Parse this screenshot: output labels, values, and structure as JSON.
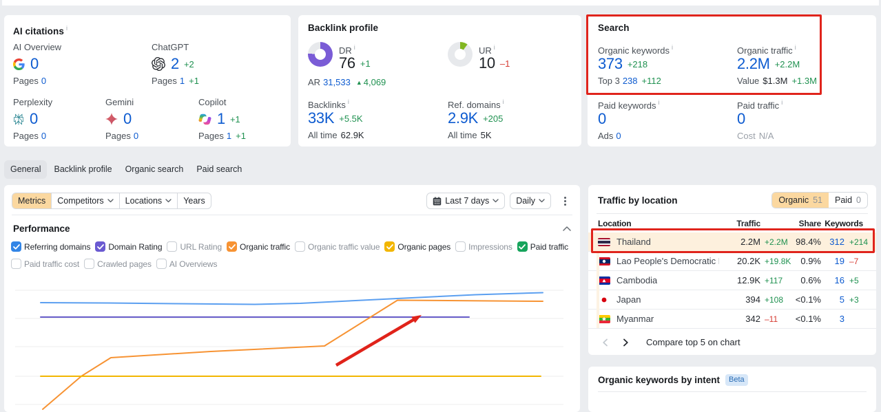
{
  "cards": {
    "ai_citations": {
      "title": "AI citations",
      "metrics": [
        {
          "label": "AI Overview",
          "icon": "google",
          "value": "0",
          "change": "",
          "pages_label": "Pages",
          "pages": "0",
          "pages_change": ""
        },
        {
          "label": "ChatGPT",
          "icon": "chatgpt",
          "value": "2",
          "change": "+2",
          "pages_label": "Pages",
          "pages": "1",
          "pages_change": "+1"
        },
        {
          "label": "Perplexity",
          "icon": "perplexity",
          "value": "0",
          "change": "",
          "pages_label": "Pages",
          "pages": "0",
          "pages_change": ""
        },
        {
          "label": "Gemini",
          "icon": "gemini",
          "value": "0",
          "change": "",
          "pages_label": "Pages",
          "pages": "0",
          "pages_change": ""
        },
        {
          "label": "Copilot",
          "icon": "copilot",
          "value": "1",
          "change": "+1",
          "pages_label": "Pages",
          "pages": "1",
          "pages_change": "+1"
        }
      ]
    },
    "backlink_profile": {
      "title": "Backlink profile",
      "dr": {
        "label": "DR",
        "value": "76",
        "change": "+1",
        "pct": 76,
        "color": "#7a5cd6",
        "track": "#e7e9ec"
      },
      "ur": {
        "label": "UR",
        "value": "10",
        "change": "–1",
        "pct": 10,
        "color": "#82b622",
        "track": "#e7e9ec"
      },
      "ar": {
        "label": "AR",
        "value": "31,533",
        "change": "4,069"
      },
      "backlinks": {
        "label": "Backlinks",
        "value": "33K",
        "change": "+5.5K",
        "sub_label": "All time",
        "sub_value": "62.9K"
      },
      "ref_domains": {
        "label": "Ref. domains",
        "value": "2.9K",
        "change": "+205",
        "sub_label": "All time",
        "sub_value": "5K"
      }
    },
    "search": {
      "title": "Search",
      "organic_keywords": {
        "label": "Organic keywords",
        "value": "373",
        "change": "+218",
        "sub_label": "Top 3",
        "sub_value": "238",
        "sub_change": "+112"
      },
      "organic_traffic": {
        "label": "Organic traffic",
        "value": "2.2M",
        "change": "+2.2M",
        "sub_label": "Value",
        "sub_value": "$1.3M",
        "sub_change": "+1.3M"
      },
      "paid_keywords": {
        "label": "Paid keywords",
        "value": "0",
        "sub_label": "Ads",
        "sub_value": "0"
      },
      "paid_traffic": {
        "label": "Paid traffic",
        "value": "0",
        "sub_label": "Cost",
        "sub_value": "N/A"
      }
    }
  },
  "tabs": [
    {
      "label": "General",
      "active": true
    },
    {
      "label": "Backlink profile",
      "active": false
    },
    {
      "label": "Organic search",
      "active": false
    },
    {
      "label": "Paid search",
      "active": false
    }
  ],
  "left_panel": {
    "filters": [
      {
        "label": "Metrics",
        "active": true
      },
      {
        "label": "Competitors",
        "dropdown": true
      },
      {
        "label": "Locations",
        "dropdown": true
      },
      {
        "label": "Years"
      }
    ],
    "date_range": "Last 7 days",
    "granularity": "Daily",
    "section_title": "Performance",
    "metrics_row1": [
      {
        "label": "Referring domains",
        "checked": true,
        "color": "#3285e6"
      },
      {
        "label": "Domain Rating",
        "checked": true,
        "color": "#6a5ad1"
      },
      {
        "label": "URL Rating",
        "checked": false
      },
      {
        "label": "Organic traffic",
        "checked": true,
        "color": "#f79333"
      },
      {
        "label": "Organic traffic value",
        "checked": false
      },
      {
        "label": "Organic pages",
        "checked": true,
        "color": "#f2b600"
      },
      {
        "label": "Impressions",
        "checked": false
      },
      {
        "label": "Paid traffic",
        "checked": true,
        "color": "#17a45c"
      }
    ],
    "metrics_row2": [
      {
        "label": "Paid traffic cost",
        "checked": false
      },
      {
        "label": "Crawled pages",
        "checked": false
      },
      {
        "label": "AI Overviews",
        "checked": false
      }
    ]
  },
  "chart_data": {
    "type": "line",
    "title": "",
    "xlabel": "",
    "ylabel": "",
    "note": "No axis tick labels are visible in the screenshot; point coordinates are pixel positions inside the 836x189 visible plot area (y grows downward), read from the rendered lines.",
    "grid": {
      "x0": 16,
      "x1": 812,
      "gridlines_y": [
        12,
        53,
        94,
        137,
        178
      ],
      "color": "#ededee"
    },
    "series": [
      {
        "name": "Referring domains",
        "color": "#5b9ff0",
        "points": [
          [
            53,
            30
          ],
          [
            150,
            30.5
          ],
          [
            250,
            31.5
          ],
          [
            364,
            32.5
          ],
          [
            430,
            31
          ],
          [
            510,
            27
          ],
          [
            571,
            24
          ],
          [
            684,
            18.5
          ],
          [
            782,
            15.5
          ]
        ]
      },
      {
        "name": "Domain Rating",
        "color": "#655bc8",
        "points": [
          [
            53,
            51
          ],
          [
            675,
            51
          ]
        ]
      },
      {
        "name": "Organic traffic",
        "color": "#f79333",
        "points": [
          [
            56,
            185
          ],
          [
            112,
            137
          ],
          [
            155,
            110
          ],
          [
            300,
            101
          ],
          [
            465,
            93
          ],
          [
            571,
            26.5
          ],
          [
            782,
            28
          ]
        ]
      },
      {
        "name": "Organic pages",
        "color": "#f2b600",
        "points": [
          [
            53,
            137
          ],
          [
            779,
            137
          ]
        ]
      }
    ],
    "legend": "checkbox row above chart acts as legend",
    "annotation_arrow": {
      "from": [
        482,
        121
      ],
      "to": [
        606,
        48
      ],
      "color": "#e0231a",
      "width": 4.5
    }
  },
  "traffic_by_location": {
    "title": "Traffic by location",
    "toggle": [
      {
        "label": "Organic",
        "count": "51",
        "active": true
      },
      {
        "label": "Paid",
        "count": "0",
        "active": false
      }
    ],
    "columns": {
      "location": "Location",
      "traffic": "Traffic",
      "share": "Share",
      "keywords": "Keywords"
    },
    "rows": [
      {
        "country": "Thailand",
        "flag": "thailand",
        "traffic": "2.2M",
        "traffic_change": "+2.2M",
        "share": "98.4%",
        "keywords": "312",
        "keywords_change": "+214",
        "highlighted": true
      },
      {
        "country": "Lao People's Democratic Reput",
        "flag": "laos",
        "traffic": "20.2K",
        "traffic_change": "+19.8K",
        "share": "0.9%",
        "keywords": "19",
        "keywords_change": "–7",
        "highlighted": false
      },
      {
        "country": "Cambodia",
        "flag": "cambodia",
        "traffic": "12.9K",
        "traffic_change": "+117",
        "share": "0.6%",
        "keywords": "16",
        "keywords_change": "+5",
        "highlighted": false
      },
      {
        "country": "Japan",
        "flag": "japan",
        "traffic": "394",
        "traffic_change": "+108",
        "share": "<0.1%",
        "keywords": "5",
        "keywords_change": "+3",
        "highlighted": false
      },
      {
        "country": "Myanmar",
        "flag": "myanmar",
        "traffic": "342",
        "traffic_change": "–11",
        "share": "<0.1%",
        "keywords": "3",
        "keywords_change": "",
        "highlighted": false
      }
    ],
    "pagination_note": "Compare top 5 on chart"
  },
  "intent_panel": {
    "title": "Organic keywords by intent",
    "badge": "Beta"
  },
  "colors": {
    "accent_blue": "#0d5bd0",
    "positive_green": "#1f9150",
    "negative_red": "#d63a31",
    "selected_peach": "#fbd8a0",
    "row_highlight": "#fdf0dd",
    "annotation_red": "#e0241c",
    "dr_donut": "#7a5cd6",
    "ur_donut": "#82b622",
    "page_bg": "#ebedf0"
  }
}
